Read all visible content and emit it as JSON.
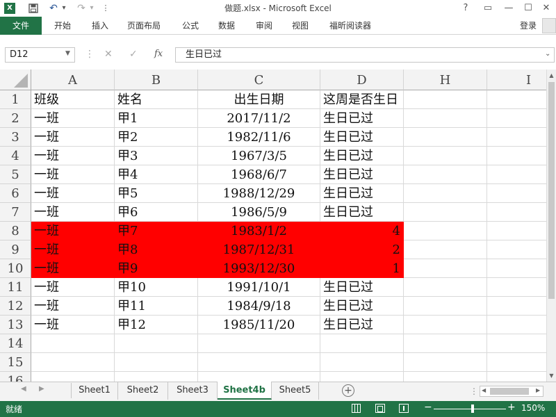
{
  "window": {
    "title": "做题.xlsx - Microsoft Excel",
    "help": "?",
    "restore": "▭",
    "minimize": "—",
    "maximize": "☐",
    "close": "✕"
  },
  "qat": {
    "undo": "↶",
    "undo_dd": "▾",
    "redo": "↷",
    "redo_dd": "▾",
    "customize": "⋮"
  },
  "ribbon": {
    "tabs": [
      "文件",
      "开始",
      "插入",
      "页面布局",
      "公式",
      "数据",
      "审阅",
      "视图",
      "福昕阅读器"
    ],
    "login": "登录"
  },
  "formula_bar": {
    "name_box": "D12",
    "cancel": "✕",
    "enter": "✓",
    "fx": "fx",
    "content": "生日已过"
  },
  "columns": [
    "A",
    "B",
    "C",
    "D",
    "H",
    "I"
  ],
  "rows": [
    {
      "n": "1",
      "a": "班级",
      "b": "姓名",
      "c": "出生日期",
      "d": "这周是否生日",
      "hl": false
    },
    {
      "n": "2",
      "a": "一班",
      "b": "甲1",
      "c": "2017/11/2",
      "d": "生日已过",
      "hl": false
    },
    {
      "n": "3",
      "a": "一班",
      "b": "甲2",
      "c": "1982/11/6",
      "d": "生日已过",
      "hl": false
    },
    {
      "n": "4",
      "a": "一班",
      "b": "甲3",
      "c": "1967/3/5",
      "d": "生日已过",
      "hl": false
    },
    {
      "n": "5",
      "a": "一班",
      "b": "甲4",
      "c": "1968/6/7",
      "d": "生日已过",
      "hl": false
    },
    {
      "n": "6",
      "a": "一班",
      "b": "甲5",
      "c": "1988/12/29",
      "d": "生日已过",
      "hl": false
    },
    {
      "n": "7",
      "a": "一班",
      "b": "甲6",
      "c": "1986/5/9",
      "d": "生日已过",
      "hl": false
    },
    {
      "n": "8",
      "a": "一班",
      "b": "甲7",
      "c": "1983/1/2",
      "d": "4",
      "hl": true
    },
    {
      "n": "9",
      "a": "一班",
      "b": "甲8",
      "c": "1987/12/31",
      "d": "2",
      "hl": true
    },
    {
      "n": "10",
      "a": "一班",
      "b": "甲9",
      "c": "1993/12/30",
      "d": "1",
      "hl": true
    },
    {
      "n": "11",
      "a": "一班",
      "b": "甲10",
      "c": "1991/10/1",
      "d": "生日已过",
      "hl": false
    },
    {
      "n": "12",
      "a": "一班",
      "b": "甲11",
      "c": "1984/9/18",
      "d": "生日已过",
      "hl": false
    },
    {
      "n": "13",
      "a": "一班",
      "b": "甲12",
      "c": "1985/11/20",
      "d": "生日已过",
      "hl": false
    },
    {
      "n": "14",
      "a": "",
      "b": "",
      "c": "",
      "d": "",
      "hl": false
    },
    {
      "n": "15",
      "a": "",
      "b": "",
      "c": "",
      "d": "",
      "hl": false
    },
    {
      "n": "16",
      "a": "",
      "b": "",
      "c": "",
      "d": "",
      "hl": false
    }
  ],
  "sheets": [
    "Sheet1",
    "Sheet2",
    "Sheet3",
    "Sheet4b",
    "Sheet5"
  ],
  "active_sheet": "Sheet4b",
  "add_sheet": "+",
  "status": {
    "ready": "就绪",
    "zoom": "150%",
    "zoom_minus": "−",
    "zoom_plus": "+"
  },
  "colors": {
    "accent": "#217346",
    "highlight": "#ff0000"
  }
}
